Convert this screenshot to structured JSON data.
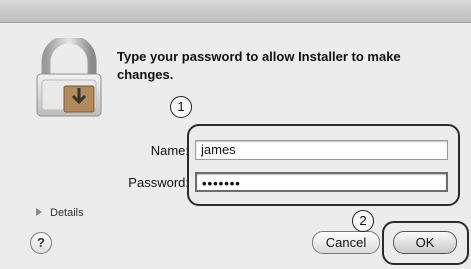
{
  "dialog": {
    "message": "Type your password to allow Installer to make changes.",
    "name_label": "Name:",
    "name_value": "james",
    "password_label": "Password:",
    "password_value": "•••••••",
    "details_label": "Details",
    "help_label": "?",
    "cancel_label": "Cancel",
    "ok_label": "OK"
  },
  "callouts": {
    "one": "1",
    "two": "2"
  }
}
